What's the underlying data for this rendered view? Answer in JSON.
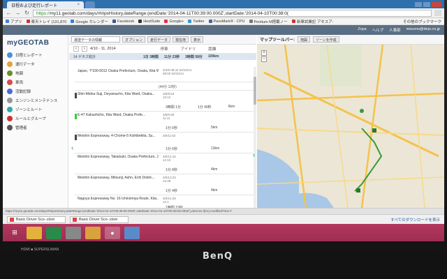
{
  "browser": {
    "tab_title": "日程および走行レポート",
    "url_scheme": "https://",
    "url_rest": "my11.geotab.com/days/#tripsHistory,dateRange:(endDate:'2014-04-11T00:39:00.000Z',startDate:'2014-04-10T00:38:0(",
    "bookmarks": [
      {
        "label": "アプリ",
        "color": "#4a7bd1"
      },
      {
        "label": "楽天トレイ (131,870",
        "color": "#c33"
      },
      {
        "label": "Google カレンダー",
        "color": "#3a7be0"
      },
      {
        "label": "Facebook",
        "color": "#3b5998"
      },
      {
        "label": "HootSuite",
        "color": "#333"
      },
      {
        "label": "Google+",
        "color": "#d34"
      },
      {
        "label": "Twitter",
        "color": "#39c"
      },
      {
        "label": "PassMark® - CPU",
        "color": "#469"
      },
      {
        "label": "Pentium M搭載ノー",
        "color": "#777"
      },
      {
        "label": "新車試乗記 アセスア-",
        "color": "#c33"
      }
    ],
    "other_bookmarks": "その他のブックマーク"
  },
  "app": {
    "header_links": [
      "Zoya",
      "ヘルプ",
      "人事部",
      "mizumo@dejo.co.jp"
    ],
    "logo_my": "my",
    "logo_geotab": "GEOTAB",
    "sidebar": [
      {
        "label": "日程とレポート",
        "icon_color": "#4a90d9"
      },
      {
        "label": "運行データ",
        "icon_color": "#e3a23c"
      },
      {
        "label": "地図",
        "icon_color": "#6b8e23"
      },
      {
        "label": "車両",
        "icon_color": "#d94a4a"
      },
      {
        "label": "活動記録",
        "icon_color": "#4a6ad9"
      },
      {
        "label": "エンジンとメンテナンス",
        "icon_color": "#999"
      },
      {
        "label": "ゾーンとルート",
        "icon_color": "#3aa"
      },
      {
        "label": "ルールとグループ",
        "icon_color": "#c33"
      },
      {
        "label": "管理者",
        "icon_color": "#555"
      }
    ],
    "toolbar": {
      "select_value": "運送データの情報",
      "buttons": [
        "オプション",
        "走行データ",
        "現在地",
        "表示"
      ]
    },
    "date_label": "4/10 - 11, 2014",
    "col_headers": [
      "停車",
      "アイドリ",
      "距離"
    ],
    "summary": {
      "vehicle": "14 ゲネズ総計",
      "stop": "1日 3時間",
      "idle": "11分 23秒",
      "dist_time": "3時間 58分",
      "dist": "109km"
    },
    "trips": [
      {
        "addr": "Japan, 〒530-0012 Osaka Prefecture, Osaka, Kita Wa...",
        "time1": "3/4/9 09:44 04/10/14",
        "time2": "08:00 04/10/14",
        "meta": [],
        "bar": "none"
      },
      {
        "divider": "(44分 12秒)"
      },
      {
        "addr": "Shin-Midou-Suji, Doyamacho, Kita Ward, Osaka...",
        "time1": "3/0/9:53",
        "time2": "10:12",
        "meta": [
          "3時間 1分",
          "1分 40秒",
          "6km"
        ],
        "bar": "dark"
      },
      {
        "addr": "E-47 Kakushicho, Kita Ward, Osaka Prefe...",
        "time1": "3/5/0:05",
        "time2": "11:11",
        "meta": [
          "1分 6秒",
          "",
          "5km"
        ],
        "bar": "green"
      },
      {
        "addr": "Meishin Expressway, 4-Chome-5 Kishibekita, Su...",
        "time1": "3/5/11:52",
        "time2": "",
        "meta": [
          "1分 6秒",
          "",
          "13km"
        ],
        "bar": "dark"
      },
      {
        "addr": "Meishin Expressway, Takatsuki, Osaka Prefecture, J...",
        "time1": "3/0/12:15",
        "time2": "12:10",
        "meta": [
          "1分 8秒",
          "",
          "4km"
        ],
        "bar": "none"
      },
      {
        "addr": "Meishin Expressway, Mitsunji, Ashn, Echi Distric...",
        "time1": "3/0/13:23",
        "time2": "12:28",
        "meta": [
          "1分 4秒",
          "",
          "4km"
        ],
        "bar": "none"
      },
      {
        "addr": "Nagoya Expressway No. 16 Ichinomiya Route, Kita...",
        "time1": "3/0/14:28",
        "time2": "12:1",
        "meta": [
          "1時間 15秒",
          "",
          ""
        ],
        "bar": "none"
      }
    ],
    "map_toolbar": {
      "title": "マップツールバー:",
      "buttons": [
        "地図",
        "ゾーンを作成"
      ]
    }
  },
  "statusbar": "https://my11.geotab.com/days/#tripsHistory,dateRange:(endDate:'2014-04-11T00:39:00.000Z',startDate:'2014-04-10T00:38:00.000Z'),devices:!(b1),modifiedTime:T",
  "downloads": [
    {
      "label": "Basic Driver Sco-.xlsm"
    },
    {
      "label": "Basic Driver Sco-.xlsm"
    }
  ],
  "downloads_all": "すべてのダウンロードを表示",
  "monitor": {
    "brand": "BenQ",
    "small_label": "HDMI ■ SUPERSLIMAN"
  }
}
